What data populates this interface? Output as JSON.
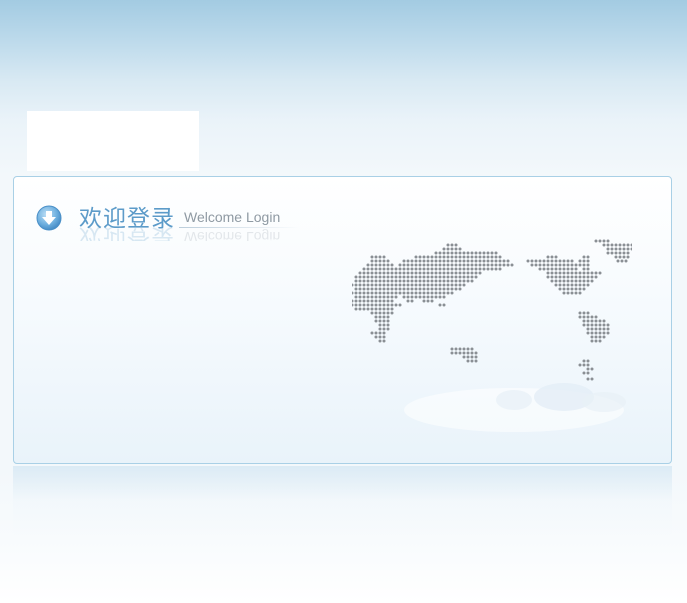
{
  "login": {
    "title_cn": "欢迎登录",
    "title_en": "Welcome Login"
  },
  "icons": {
    "header": "arrow-down-circle-icon",
    "map": "world-map-dots"
  },
  "colors": {
    "title_blue": "#5c9bc9",
    "subtitle_gray": "#8f9aa3",
    "panel_border": "#a9d0e6",
    "map_dot": "#8a8f94"
  }
}
